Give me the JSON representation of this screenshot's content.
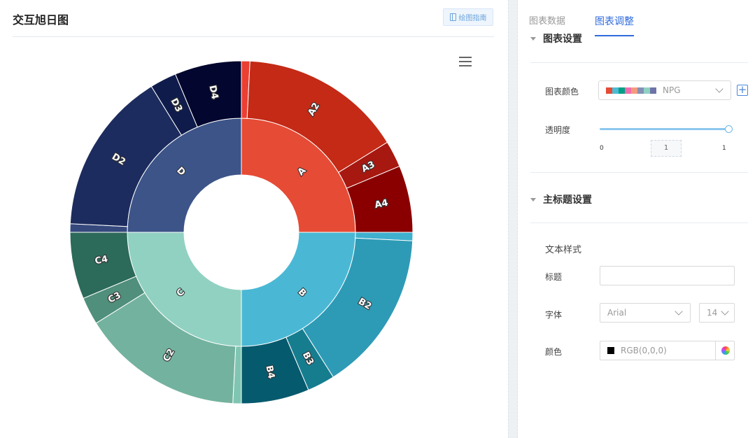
{
  "header": {
    "title": "交互旭日图",
    "guide_label": "绘图指南"
  },
  "icons": {
    "guide": "book-icon",
    "menu": "hamburger-menu-icon",
    "section_toggle": "caret-down-icon",
    "add": "plus-icon",
    "select": "chevron-down-icon",
    "color_picker": "color-wheel-icon"
  },
  "chart_data": {
    "type": "sunburst",
    "inner": [
      {
        "name": "A",
        "value": 25,
        "color": "#e64b35"
      },
      {
        "name": "B",
        "value": 25,
        "color": "#4ab8d5"
      },
      {
        "name": "C",
        "value": 25,
        "color": "#91d1c2"
      },
      {
        "name": "D",
        "value": 25,
        "color": "#3c5488"
      }
    ],
    "outer": [
      {
        "name": "",
        "parent": "A",
        "value": 0.8,
        "color": "#ea3f32"
      },
      {
        "name": "A2",
        "parent": "A",
        "value": 15.4,
        "color": "#c42a16"
      },
      {
        "name": "A3",
        "parent": "A",
        "value": 2.5,
        "color": "#a71810"
      },
      {
        "name": "A4",
        "parent": "A",
        "value": 6.3,
        "color": "#8a0000"
      },
      {
        "name": "",
        "parent": "B",
        "value": 0.8,
        "color": "#3fb0ce"
      },
      {
        "name": "B2",
        "parent": "B",
        "value": 15.2,
        "color": "#2e9bb6"
      },
      {
        "name": "B3",
        "parent": "B",
        "value": 2.6,
        "color": "#167d8f"
      },
      {
        "name": "B4",
        "parent": "B",
        "value": 6.4,
        "color": "#065a6e"
      },
      {
        "name": "",
        "parent": "C",
        "value": 0.8,
        "color": "#80c5b2"
      },
      {
        "name": "C2",
        "parent": "C",
        "value": 15.3,
        "color": "#73b29e"
      },
      {
        "name": "C3",
        "parent": "C",
        "value": 2.6,
        "color": "#4f8f7b"
      },
      {
        "name": "C4",
        "parent": "C",
        "value": 6.3,
        "color": "#2c6a5a"
      },
      {
        "name": "",
        "parent": "D",
        "value": 0.8,
        "color": "#35497d"
      },
      {
        "name": "D2",
        "parent": "D",
        "value": 15.4,
        "color": "#1d2c5e"
      },
      {
        "name": "D3",
        "parent": "D",
        "value": 2.5,
        "color": "#0f1c4b"
      },
      {
        "name": "D4",
        "parent": "D",
        "value": 6.3,
        "color": "#03062e"
      }
    ]
  },
  "right_panel": {
    "tabs": [
      {
        "label": "图表数据",
        "active": false
      },
      {
        "label": "图表调整",
        "active": true
      }
    ],
    "chart_settings": {
      "header": "图表设置",
      "color_label": "图表颜色",
      "palette_name": "NPG",
      "palette_swatches": [
        "#e64b35",
        "#4dbbd5",
        "#00a087",
        "#f16eae",
        "#f39b7f",
        "#8491b4",
        "#91d1c2",
        "#6e74a8"
      ],
      "opacity_label": "透明度",
      "opacity_value": "1",
      "opacity_min": "0",
      "opacity_max": "1",
      "opacity_fraction": 1
    },
    "main_title_settings": {
      "header": "主标题设置",
      "text_style_label": "文本样式",
      "title_label": "标题",
      "title_value": "",
      "font_label": "字体",
      "font_value": "Arial",
      "font_size_value": "14",
      "color_label": "颜色",
      "color_value": "RGB(0,0,0)"
    }
  }
}
